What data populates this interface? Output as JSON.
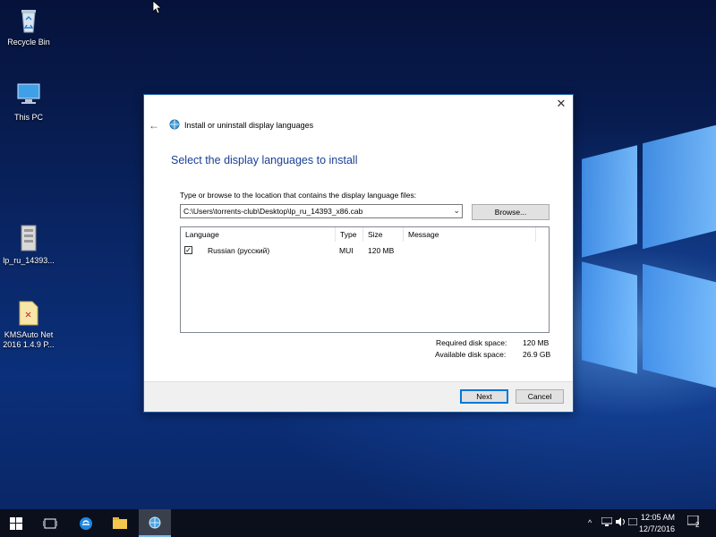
{
  "desktop": {
    "icons": [
      {
        "label": "Recycle Bin",
        "icon": "recycle-bin-icon"
      },
      {
        "label": "This PC",
        "icon": "this-pc-icon"
      },
      {
        "label": "lp_ru_14393...",
        "icon": "cab-file-icon"
      },
      {
        "label": "KMSAuto Net 2016 1.4.9 P...",
        "icon": "folder-icon"
      }
    ]
  },
  "dialog": {
    "title": "Install or uninstall display languages",
    "heading": "Select the display languages to install",
    "path_label": "Type or browse to the location that contains the display language files:",
    "path_value": "C:\\Users\\torrents-club\\Desktop\\lp_ru_14393_x86.cab",
    "browse_label": "Browse...",
    "columns": [
      "Language",
      "Type",
      "Size",
      "Message"
    ],
    "rows": [
      {
        "checked": true,
        "language": "Russian (русский)",
        "type": "MUI",
        "size": "120 MB",
        "message": ""
      }
    ],
    "required_label": "Required disk space:",
    "required_value": "120 MB",
    "available_label": "Available disk space:",
    "available_value": "26.9 GB",
    "next_label": "Next",
    "cancel_label": "Cancel",
    "close_glyph": "✕",
    "back_glyph": "←"
  },
  "taskbar": {
    "time": "12:05 AM",
    "date": "12/7/2016",
    "notification_count": "2",
    "chevron": "^",
    "accent": "#76b9ed"
  }
}
